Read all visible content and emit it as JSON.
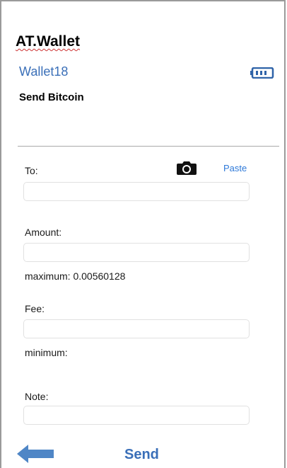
{
  "header": {
    "app_title": "AT.Wallet",
    "wallet_name": "Wallet18",
    "page_title": "Send Bitcoin"
  },
  "form": {
    "to_label": "To:",
    "paste_label": "Paste",
    "to_value": "",
    "amount_label": "Amount:",
    "amount_value": "",
    "amount_hint": "maximum: 0.00560128",
    "fee_label": "Fee:",
    "fee_value": "",
    "fee_hint": "minimum:",
    "note_label": "Note:",
    "note_value": ""
  },
  "footer": {
    "send_label": "Send"
  },
  "icons": {
    "battery": "battery-icon",
    "camera": "camera-icon",
    "back": "back-arrow-icon"
  },
  "colors": {
    "accent": "#3a6fb8",
    "link": "#2f7ad9"
  }
}
